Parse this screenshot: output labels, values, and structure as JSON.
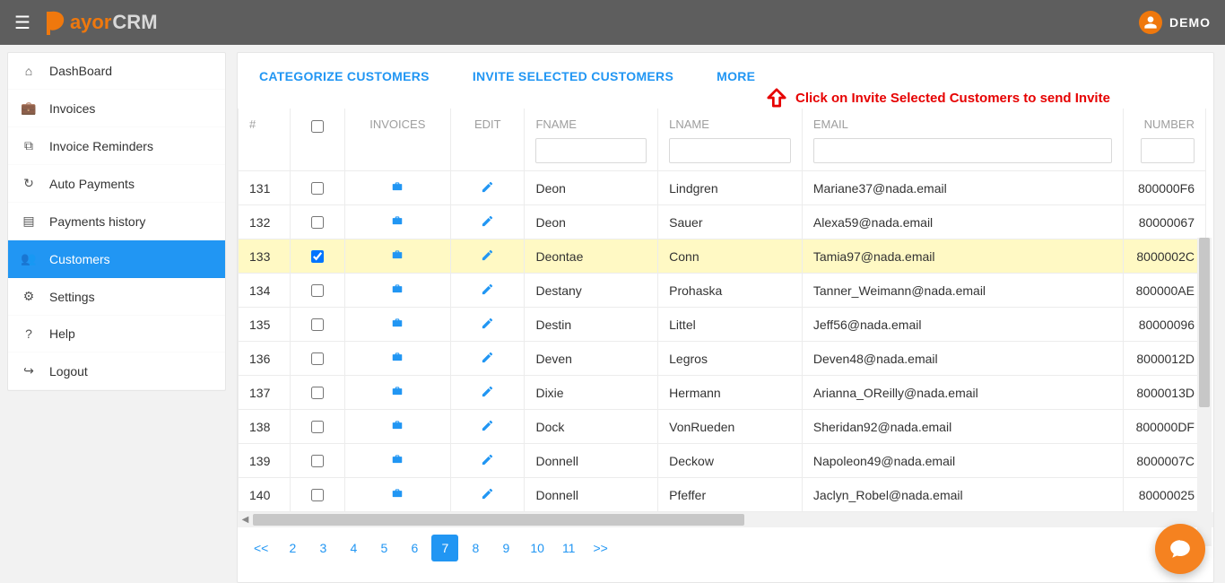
{
  "header": {
    "brand_prefix": "P",
    "brand_mid": "ayor",
    "brand_suffix": "CRM",
    "user_name": "DEMO"
  },
  "sidebar": {
    "items": [
      {
        "icon": "home-icon",
        "label": "DashBoard",
        "active": false
      },
      {
        "icon": "briefcase-icon",
        "label": "Invoices",
        "active": false
      },
      {
        "icon": "reminder-icon",
        "label": "Invoice Reminders",
        "active": false
      },
      {
        "icon": "refresh-icon",
        "label": "Auto Payments",
        "active": false
      },
      {
        "icon": "card-icon",
        "label": "Payments history",
        "active": false
      },
      {
        "icon": "users-icon",
        "label": "Customers",
        "active": true
      },
      {
        "icon": "gear-icon",
        "label": "Settings",
        "active": false
      },
      {
        "icon": "help-icon",
        "label": "Help",
        "active": false
      },
      {
        "icon": "logout-icon",
        "label": "Logout",
        "active": false
      }
    ]
  },
  "actions": {
    "categorize": "CATEGORIZE CUSTOMERS",
    "invite": "INVITE SELECTED CUSTOMERS",
    "more": "MORE"
  },
  "callout": "Click on Invite Selected Customers to send Invite",
  "columns": {
    "idx": "#",
    "invoices": "INVOICES",
    "edit": "EDIT",
    "fname": "FNAME",
    "lname": "LNAME",
    "email": "EMAIL",
    "number": "NUMBER"
  },
  "rows": [
    {
      "idx": "131",
      "chk": false,
      "fname": "Deon",
      "lname": "Lindgren",
      "email": "Mariane37@nada.email",
      "number": "800000F6"
    },
    {
      "idx": "132",
      "chk": false,
      "fname": "Deon",
      "lname": "Sauer",
      "email": "Alexa59@nada.email",
      "number": "80000067"
    },
    {
      "idx": "133",
      "chk": true,
      "fname": "Deontae",
      "lname": "Conn",
      "email": "Tamia97@nada.email",
      "number": "8000002C"
    },
    {
      "idx": "134",
      "chk": false,
      "fname": "Destany",
      "lname": "Prohaska",
      "email": "Tanner_Weimann@nada.email",
      "number": "800000AE"
    },
    {
      "idx": "135",
      "chk": false,
      "fname": "Destin",
      "lname": "Littel",
      "email": "Jeff56@nada.email",
      "number": "80000096"
    },
    {
      "idx": "136",
      "chk": false,
      "fname": "Deven",
      "lname": "Legros",
      "email": "Deven48@nada.email",
      "number": "8000012D"
    },
    {
      "idx": "137",
      "chk": false,
      "fname": "Dixie",
      "lname": "Hermann",
      "email": "Arianna_OReilly@nada.email",
      "number": "8000013D"
    },
    {
      "idx": "138",
      "chk": false,
      "fname": "Dock",
      "lname": "VonRueden",
      "email": "Sheridan92@nada.email",
      "number": "800000DF"
    },
    {
      "idx": "139",
      "chk": false,
      "fname": "Donnell",
      "lname": "Deckow",
      "email": "Napoleon49@nada.email",
      "number": "8000007C"
    },
    {
      "idx": "140",
      "chk": false,
      "fname": "Donnell",
      "lname": "Pfeffer",
      "email": "Jaclyn_Robel@nada.email",
      "number": "80000025"
    }
  ],
  "pager": {
    "first": "<<",
    "pages": [
      "2",
      "3",
      "4",
      "5",
      "6",
      "7",
      "8",
      "9",
      "10",
      "11"
    ],
    "current": "7",
    "next": ">>"
  }
}
